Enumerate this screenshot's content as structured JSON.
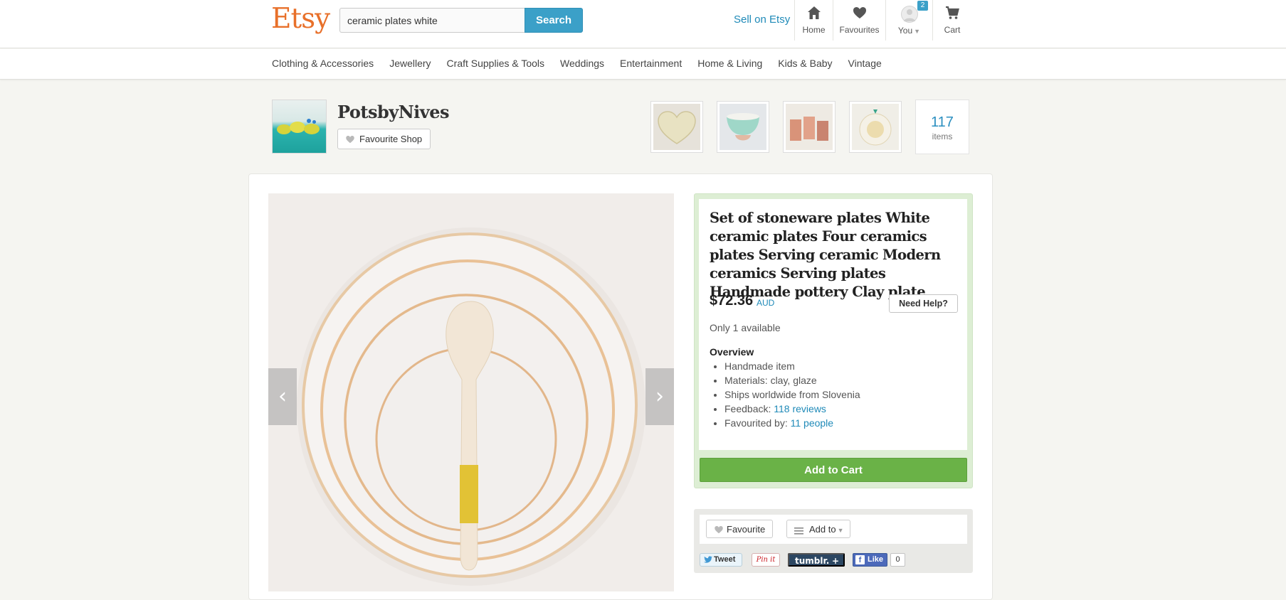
{
  "brand": {
    "logo": "Etsy",
    "accent": "#e8702a"
  },
  "search": {
    "value": "ceramic plates white",
    "button_label": "Search"
  },
  "header_nav": {
    "sell_link": "Sell on Etsy",
    "home": "Home",
    "favourites": "Favourites",
    "you": "You",
    "you_badge": "2",
    "cart": "Cart"
  },
  "categories": [
    "Clothing & Accessories",
    "Jewellery",
    "Craft Supplies & Tools",
    "Weddings",
    "Entertainment",
    "Home & Living",
    "Kids & Baby",
    "Vintage"
  ],
  "shop": {
    "name": "PotsbyNives",
    "favourite_button": "Favourite Shop",
    "items_count": "117",
    "items_label": "items"
  },
  "listing": {
    "title": "Set of stoneware plates White ceramic plates Four ceramics plates Serving ceramic Modern ceramics Serving plates Handmade pottery Clay plate",
    "price": "$72.36",
    "currency": "AUD",
    "help_button": "Need Help?",
    "availability": "Only 1 available",
    "overview_title": "Overview",
    "overview": {
      "handmade": "Handmade item",
      "materials": "Materials: clay, glaze",
      "ships": "Ships worldwide from Slovenia",
      "feedback_label": "Feedback: ",
      "feedback_link": "118 reviews",
      "favourited_label": "Favourited by: ",
      "favourited_link": "11 people"
    },
    "add_to_cart": "Add to Cart"
  },
  "actions": {
    "favourite": "Favourite",
    "add_to": "Add to"
  },
  "social": {
    "tweet": "Tweet",
    "pin": "Pin it",
    "tumblr": "tumblr.",
    "tumblr_plus": "+",
    "fb_like": "Like",
    "fb_count": "0"
  },
  "colors": {
    "link": "#1f8ab8",
    "search_button": "#3ba0c8",
    "add_to_cart": "#6ab247",
    "buybox_border": "#ddeed4"
  }
}
